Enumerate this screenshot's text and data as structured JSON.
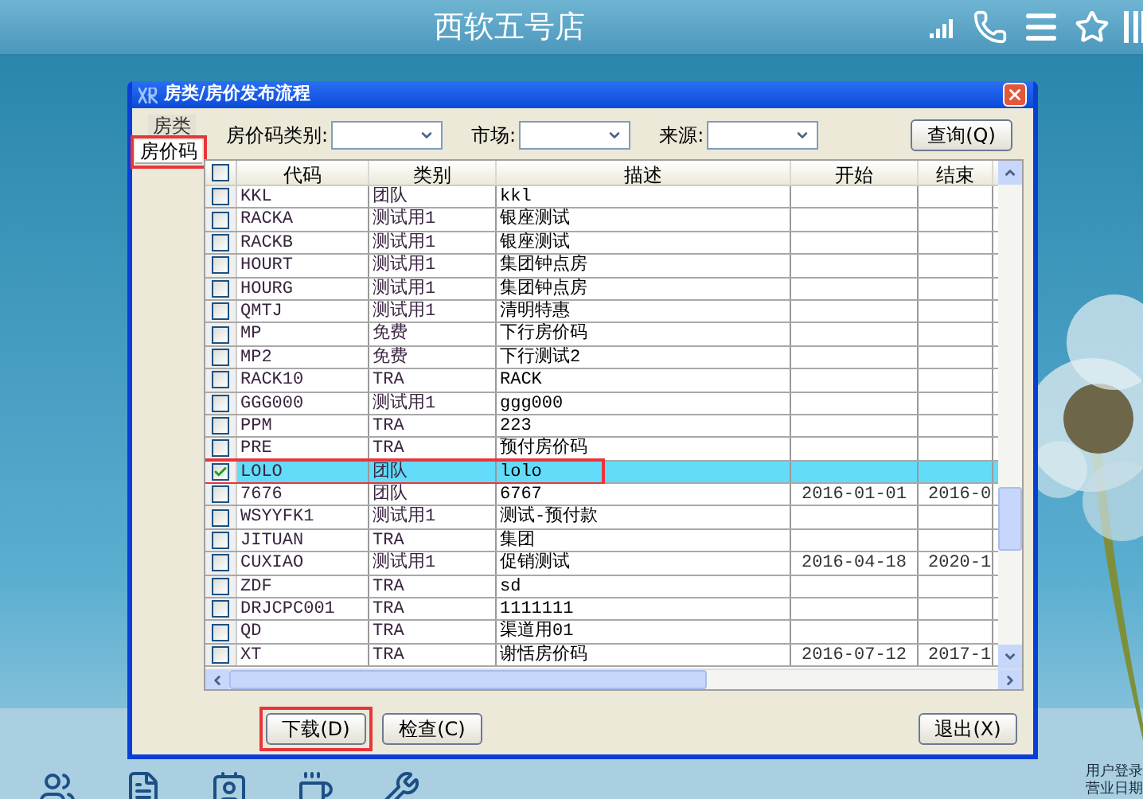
{
  "app_bar": {
    "title": "西软五号店"
  },
  "dialog": {
    "title": "房类/房价发布流程",
    "side_tabs": [
      {
        "label": "房类",
        "selected": false,
        "highlighted": false
      },
      {
        "label": "房价码",
        "selected": true,
        "highlighted": true
      }
    ],
    "filters": [
      {
        "label": "房价码类别:"
      },
      {
        "label": "市场:"
      },
      {
        "label": "来源:"
      }
    ],
    "query_button": "查询(Q)",
    "table": {
      "columns": [
        "代码",
        "类别",
        "描述",
        "开始",
        "结束"
      ],
      "all_checked": false,
      "rows": [
        {
          "code": "KKL",
          "type": "团队",
          "desc": "kkl",
          "start": "",
          "end": "",
          "checked": false,
          "selected": false,
          "highlighted": false
        },
        {
          "code": "RACKA",
          "type": "测试用1",
          "desc": "银座测试",
          "start": "",
          "end": "",
          "checked": false,
          "selected": false,
          "highlighted": false
        },
        {
          "code": "RACKB",
          "type": "测试用1",
          "desc": "银座测试",
          "start": "",
          "end": "",
          "checked": false,
          "selected": false,
          "highlighted": false
        },
        {
          "code": "HOURT",
          "type": "测试用1",
          "desc": "集团钟点房",
          "start": "",
          "end": "",
          "checked": false,
          "selected": false,
          "highlighted": false
        },
        {
          "code": "HOURG",
          "type": "测试用1",
          "desc": "集团钟点房",
          "start": "",
          "end": "",
          "checked": false,
          "selected": false,
          "highlighted": false
        },
        {
          "code": "QMTJ",
          "type": "测试用1",
          "desc": "清明特惠",
          "start": "",
          "end": "",
          "checked": false,
          "selected": false,
          "highlighted": false
        },
        {
          "code": "MP",
          "type": "免费",
          "desc": "下行房价码",
          "start": "",
          "end": "",
          "checked": false,
          "selected": false,
          "highlighted": false
        },
        {
          "code": "MP2",
          "type": "免费",
          "desc": "下行测试2",
          "start": "",
          "end": "",
          "checked": false,
          "selected": false,
          "highlighted": false
        },
        {
          "code": "RACK10",
          "type": "TRA",
          "desc": "RACK",
          "start": "",
          "end": "",
          "checked": false,
          "selected": false,
          "highlighted": false
        },
        {
          "code": "GGG000",
          "type": "测试用1",
          "desc": "ggg000",
          "start": "",
          "end": "",
          "checked": false,
          "selected": false,
          "highlighted": false
        },
        {
          "code": "PPM",
          "type": "TRA",
          "desc": "223",
          "start": "",
          "end": "",
          "checked": false,
          "selected": false,
          "highlighted": false
        },
        {
          "code": "PRE",
          "type": "TRA",
          "desc": "预付房价码",
          "start": "",
          "end": "",
          "checked": false,
          "selected": false,
          "highlighted": false
        },
        {
          "code": "LOLO",
          "type": "团队",
          "desc": "lolo",
          "start": "",
          "end": "",
          "checked": true,
          "selected": true,
          "highlighted": true
        },
        {
          "code": "7676",
          "type": "团队",
          "desc": "6767",
          "start": "2016-01-01",
          "end": "2016-0",
          "checked": false,
          "selected": false,
          "highlighted": false
        },
        {
          "code": "WSYYFK1",
          "type": "测试用1",
          "desc": "测试-预付款",
          "start": "",
          "end": "",
          "checked": false,
          "selected": false,
          "highlighted": false
        },
        {
          "code": "JITUAN",
          "type": "TRA",
          "desc": "集团",
          "start": "",
          "end": "",
          "checked": false,
          "selected": false,
          "highlighted": false
        },
        {
          "code": "CUXIAO",
          "type": "测试用1",
          "desc": "促销测试",
          "start": "2016-04-18",
          "end": "2020-1",
          "checked": false,
          "selected": false,
          "highlighted": false
        },
        {
          "code": "ZDF",
          "type": "TRA",
          "desc": "sd",
          "start": "",
          "end": "",
          "checked": false,
          "selected": false,
          "highlighted": false
        },
        {
          "code": "DRJCPC001",
          "type": "TRA",
          "desc": "1111111",
          "start": "",
          "end": "",
          "checked": false,
          "selected": false,
          "highlighted": false
        },
        {
          "code": "QD",
          "type": "TRA",
          "desc": "渠道用01",
          "start": "",
          "end": "",
          "checked": false,
          "selected": false,
          "highlighted": false
        },
        {
          "code": "XT",
          "type": "TRA",
          "desc": "谢恬房价码",
          "start": "2016-07-12",
          "end": "2017-1",
          "checked": false,
          "selected": false,
          "highlighted": false
        }
      ]
    },
    "buttons": [
      {
        "label": "下载(D)",
        "highlighted": true
      },
      {
        "label": "检查(C)",
        "highlighted": false
      }
    ],
    "exit_button": "退出(X)"
  },
  "side_info": [
    "用户登录",
    "营业日期"
  ]
}
